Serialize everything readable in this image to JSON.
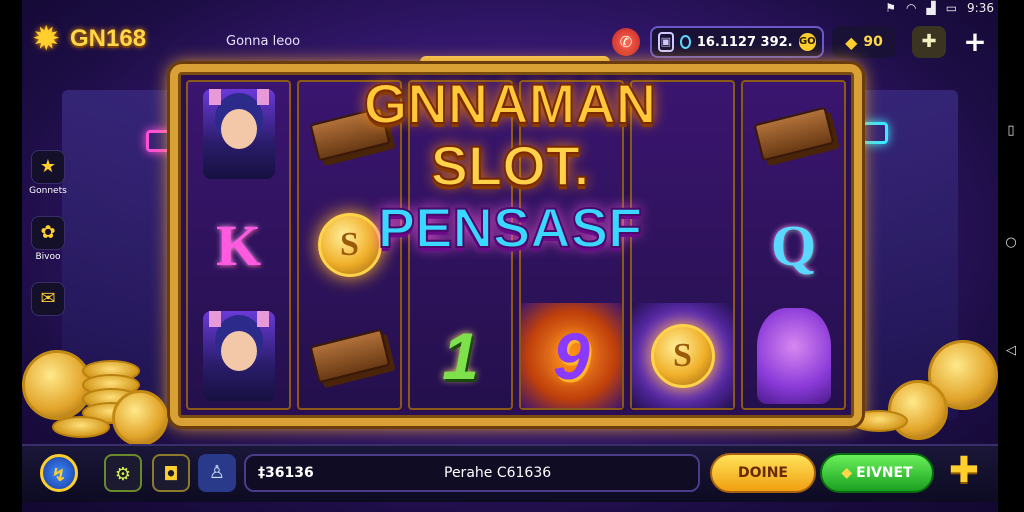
{
  "status": {
    "time": "9:36"
  },
  "header": {
    "logo_text": "GN168",
    "game_name": "Gonna leoo",
    "balance": "16.1127 392.",
    "balance_go": "GO",
    "gems": "90"
  },
  "side_menu": [
    {
      "label": "Gonnets",
      "icon": "star-badge-icon"
    },
    {
      "label": "Bivoo",
      "icon": "lucky-bag-icon"
    },
    {
      "label": "",
      "icon": "envelope-icon"
    }
  ],
  "title": {
    "line1": "GNNAMAN",
    "line2": "SLOT.",
    "line3": "PENSASF"
  },
  "reels": [
    [
      "hero",
      "K",
      "hero"
    ],
    [
      "gold-bar",
      "coin",
      "gold-bar"
    ],
    [
      "",
      "",
      "1"
    ],
    [
      "",
      "",
      "9"
    ],
    [
      "",
      "",
      "coin"
    ],
    [
      "gold-bar",
      "Q",
      "creature"
    ]
  ],
  "bottom": {
    "bet_value": "‡36136",
    "bet_label": "Perahe C61636",
    "done_label": "DOINE",
    "invest_label": "EIVNET"
  },
  "colors": {
    "accent_gold": "#ffcf2e",
    "frame_gold": "#d9a035",
    "bg_purple": "#3a1a78",
    "done_yellow": "#f0a010",
    "invest_green": "#1aa020"
  }
}
